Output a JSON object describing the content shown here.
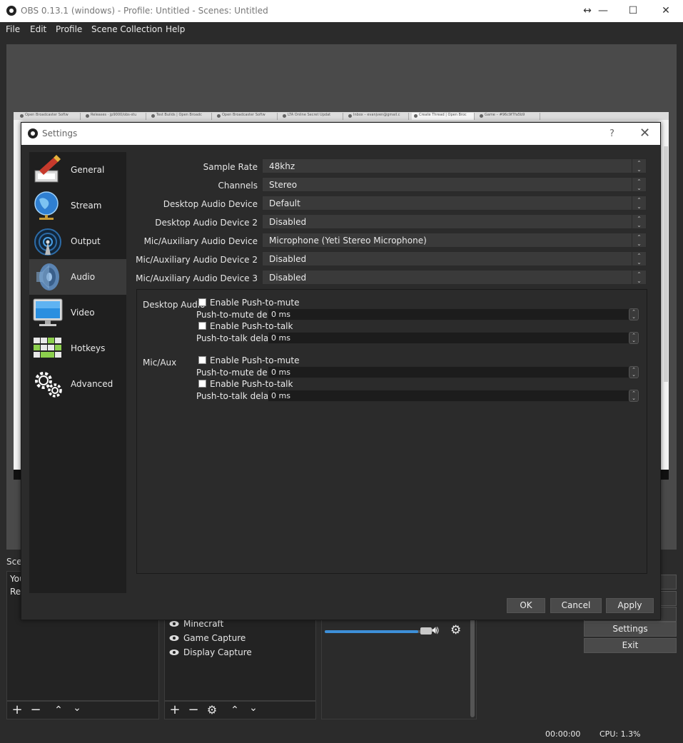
{
  "window": {
    "title": "OBS 0.13.1 (windows) - Profile: Untitled - Scenes: Untitled",
    "controls": [
      "↔",
      "—",
      "☐",
      "✕"
    ]
  },
  "menu": [
    "File",
    "Edit",
    "Profile",
    "Scene Collection",
    "Help"
  ],
  "capture_tabs": [
    "Open Broadcaster Softw",
    "Releases · jp9000/obs-stu",
    "Test Builds | Open Broadc",
    "Open Broadcaster Softw",
    "LTA Online Secret Updat",
    "Inbox – evanjven@gmail.c",
    "Create Thread | Open Broc",
    "Game – #96c9f7fa5b9"
  ],
  "main": {
    "scenes_label": "Scen",
    "scenes": [
      "You",
      "Rec"
    ],
    "sources": [
      "Minecraft",
      "Game Capture",
      "Display Capture"
    ],
    "controls": {
      "settings": "Settings",
      "exit": "Exit"
    },
    "mixer_volume": 0.9
  },
  "status": {
    "time": "00:00:00",
    "cpu": "CPU: 1.3%"
  },
  "dialog": {
    "title": "Settings",
    "help": "?",
    "close": "✕",
    "nav": [
      {
        "label": "General",
        "icon": "general-icon",
        "active": false
      },
      {
        "label": "Stream",
        "icon": "stream-globe-icon",
        "active": false
      },
      {
        "label": "Output",
        "icon": "output-antenna-icon",
        "active": false
      },
      {
        "label": "Audio",
        "icon": "audio-speaker-icon",
        "active": true
      },
      {
        "label": "Video",
        "icon": "video-monitor-icon",
        "active": false
      },
      {
        "label": "Hotkeys",
        "icon": "hotkeys-keyboard-icon",
        "active": false
      },
      {
        "label": "Advanced",
        "icon": "advanced-gears-icon",
        "active": false
      }
    ],
    "fields": [
      {
        "label": "Sample Rate",
        "value": "48khz"
      },
      {
        "label": "Channels",
        "value": "Stereo"
      },
      {
        "label": "Desktop Audio Device",
        "value": "Default"
      },
      {
        "label": "Desktop Audio Device 2",
        "value": "Disabled"
      },
      {
        "label": "Mic/Auxiliary Audio Device",
        "value": "Microphone (Yeti Stereo Microphone)"
      },
      {
        "label": "Mic/Auxiliary Audio Device 2",
        "value": "Disabled"
      },
      {
        "label": "Mic/Auxiliary Audio Device 3",
        "value": "Disabled"
      }
    ],
    "hotkey_sections": [
      {
        "name": "Desktop Audio",
        "push_to_mute_label": "Enable Push-to-mute",
        "push_to_mute_delay_label": "Push-to-mute delay",
        "push_to_mute_delay": "0 ms",
        "push_to_talk_label": "Enable Push-to-talk",
        "push_to_talk_delay_label": "Push-to-talk delay",
        "push_to_talk_delay": "0 ms"
      },
      {
        "name": "Mic/Aux",
        "push_to_mute_label": "Enable Push-to-mute",
        "push_to_mute_delay_label": "Push-to-mute delay",
        "push_to_mute_delay": "0 ms",
        "push_to_talk_label": "Enable Push-to-talk",
        "push_to_talk_delay_label": "Push-to-talk delay",
        "push_to_talk_delay": "0 ms"
      }
    ],
    "buttons": {
      "ok": "OK",
      "cancel": "Cancel",
      "apply": "Apply"
    }
  }
}
